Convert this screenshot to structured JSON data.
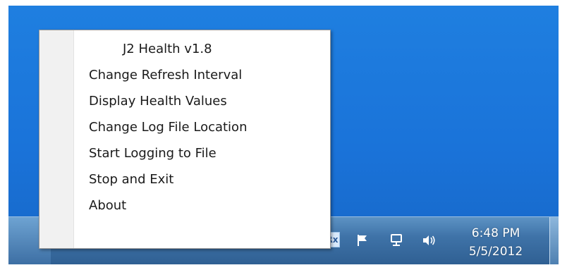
{
  "menu": {
    "header": "J2 Health v1.8",
    "items": [
      {
        "label": "Change Refresh Interval"
      },
      {
        "label": "Display Health Values"
      },
      {
        "label": "Change Log File Location"
      },
      {
        "label": "Start Logging to File"
      },
      {
        "label": "Stop and Exit"
      },
      {
        "label": "About"
      }
    ]
  },
  "tray": {
    "icons": [
      "show-hidden-icons-arrow-icon",
      "rx-app-icon",
      "action-center-flag-icon",
      "network-icon",
      "volume-icon"
    ],
    "rx_label": "Rx"
  },
  "clock": {
    "time": "6:48 PM",
    "date": "5/5/2012"
  },
  "colors": {
    "desktop": "#1a73d9",
    "taskbar": "#3f73a8",
    "menu_background": "#ffffff",
    "menu_gutter": "#f1f1f1",
    "menu_text": "#1a1a1a"
  }
}
